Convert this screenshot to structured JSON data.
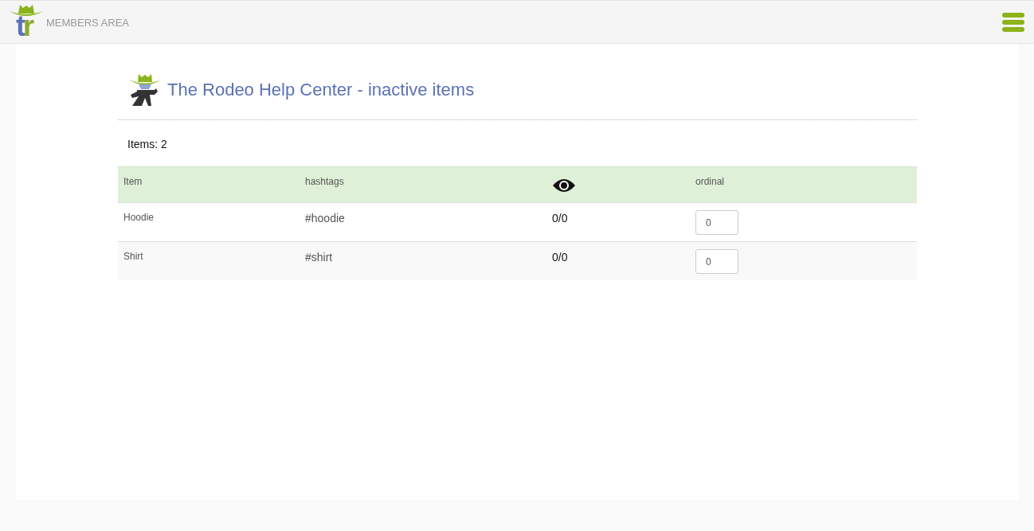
{
  "header": {
    "logo_text": "tr",
    "title": "MEMBERS AREA"
  },
  "page": {
    "title": "The Rodeo Help Center - inactive items",
    "count": "Items: 2"
  },
  "table": {
    "columns": [
      {
        "kind": "text",
        "label": "Item"
      },
      {
        "kind": "text",
        "label": "hashtags"
      },
      {
        "kind": "icon"
      },
      {
        "kind": "text",
        "label": "ordinal"
      }
    ],
    "rows": [
      {
        "item": "Hoodie",
        "hashtags": "#hoodie",
        "views": "0/0",
        "ordinal": "0"
      },
      {
        "item": "Shirt",
        "hashtags": "#shirt",
        "views": "0/0",
        "ordinal": "0"
      }
    ]
  }
}
